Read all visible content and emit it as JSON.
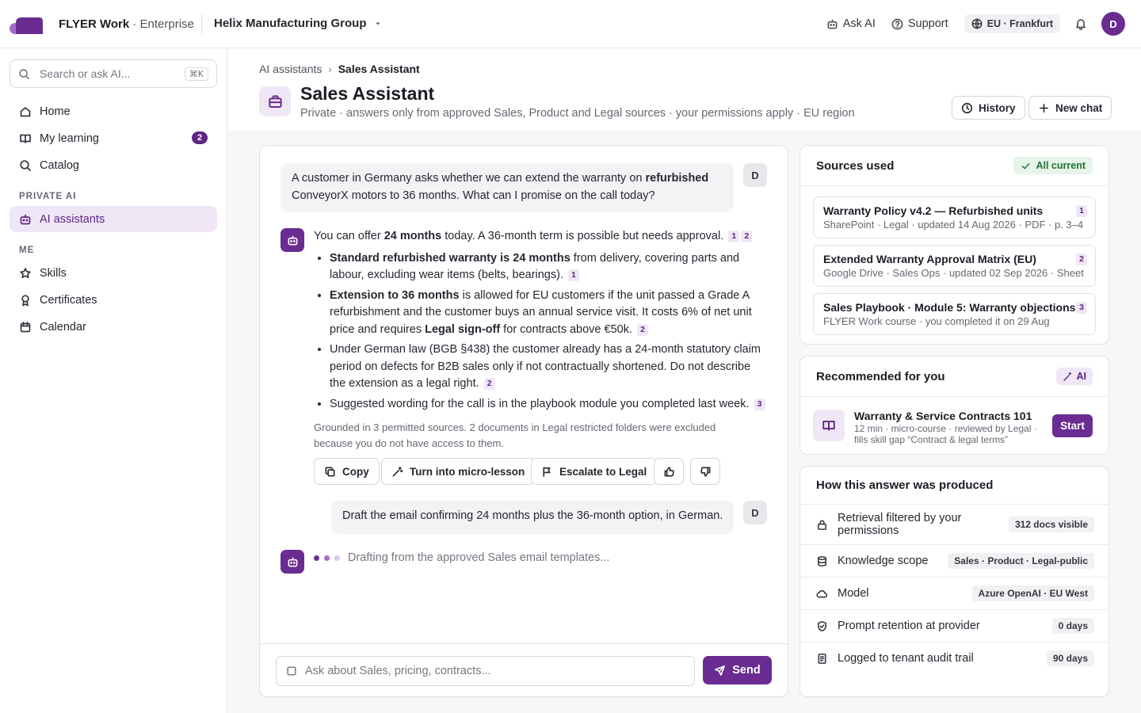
{
  "app": {
    "brand": "FLYER Work",
    "edition": "Enterprise",
    "org": "Helix Manufacturing Group"
  },
  "topbar": {
    "ask_ai": "Ask AI",
    "support": "Support",
    "region": "EU · Frankfurt",
    "avatar": "D"
  },
  "sidebar": {
    "search_placeholder": "Search or ask AI...",
    "search_shortcut": "⌘K",
    "items": [
      {
        "label": "Home",
        "icon": "home-icon"
      },
      {
        "label": "My learning",
        "icon": "book-icon",
        "badge": "2"
      },
      {
        "label": "Catalog",
        "icon": "search-icon"
      }
    ],
    "section_private": "PRIVATE AI",
    "ai_assistants": "AI assistants",
    "section_me": "ME",
    "me_items": [
      {
        "label": "Skills",
        "icon": "star-icon"
      },
      {
        "label": "Certificates",
        "icon": "ribbon-icon"
      },
      {
        "label": "Calendar",
        "icon": "calendar-icon"
      }
    ]
  },
  "header": {
    "crumb_parent": "AI assistants",
    "crumb_current": "Sales Assistant",
    "title": "Sales Assistant",
    "subtitle": "Private · answers only from approved Sales, Product and Legal sources · your permissions apply · EU region",
    "history": "History",
    "new_chat": "New chat"
  },
  "chat": {
    "user_avatar": "D",
    "q1_a": "A customer in Germany asks whether we can extend the warranty on ",
    "q1_b": "refurbished",
    "q1_c": " ConveyorX motors to 36 months. What can I promise on the call today?",
    "a_intro_a": "You can offer ",
    "a_intro_b": "24 months",
    "a_intro_c": " today. A 36-month term is possible but needs approval.",
    "b1_bold": "Standard refurbished warranty is 24 months",
    "b1_text": " from delivery, covering parts and labour, excluding wear items (belts, bearings).",
    "b2_bold": "Extension to 36 months",
    "b2_text": " is allowed for EU customers if the unit passed a Grade A refurbishment and the customer buys an annual service visit. It costs 6% of net unit price and requires ",
    "b2_bold2": "Legal sign-off",
    "b2_text2": " for contracts above €50k.",
    "b3_text": "Under German law (BGB §438) the customer already has a 24-month statutory claim period on defects for B2B sales only if not contractually shortened. Do not describe the extension as a legal right.",
    "b4_text": "Suggested wording for the call is in the playbook module you completed last week.",
    "c1": "1",
    "c2": "2",
    "c3": "3",
    "grounded": "Grounded in 3 permitted sources. 2 documents in Legal restricted folders were excluded because you do not have access to them.",
    "copy": "Copy",
    "micro": "Turn into micro-lesson",
    "escalate": "Escalate to Legal",
    "q2": "Draft the email confirming 24 months plus the 36-month option, in German.",
    "typing": "Drafting from the approved Sales email templates...",
    "placeholder": "Ask about Sales, pricing, contracts...",
    "send": "Send"
  },
  "sources": {
    "title": "Sources used",
    "status": "All current",
    "items": [
      {
        "title": "Warranty Policy v4.2 — Refurbished units",
        "meta": "SharePoint · Legal · updated 14 Aug 2026 · PDF · p. 3–4",
        "n": "1"
      },
      {
        "title": "Extended Warranty Approval Matrix (EU)",
        "meta": "Google Drive · Sales Ops · updated 02 Sep 2026 · Sheet",
        "n": "2"
      },
      {
        "title": "Sales Playbook · Module 5: Warranty objections",
        "meta": "FLYER Work course · you completed it on 29 Aug",
        "n": "3"
      }
    ]
  },
  "recommended": {
    "title": "Recommended for you",
    "badge": "AI",
    "course": "Warranty & Service Contracts 101",
    "meta": "12 min · micro-course · reviewed by Legal · fills skill gap “Contract & legal terms”",
    "start": "Start"
  },
  "produced": {
    "title": "How this answer was produced",
    "rows": [
      {
        "label": "Retrieval filtered by your permissions",
        "value": "312 docs visible",
        "icon": "lock-icon"
      },
      {
        "label": "Knowledge scope",
        "value": "Sales · Product · Legal-public",
        "icon": "database-icon"
      },
      {
        "label": "Model",
        "value": "Azure OpenAI · EU West",
        "icon": "cloud-icon"
      },
      {
        "label": "Prompt retention at provider",
        "value": "0 days",
        "icon": "shield-icon"
      },
      {
        "label": "Logged to tenant audit trail",
        "value": "90 days",
        "icon": "document-icon"
      }
    ]
  },
  "colors": {
    "accent": "#6b2c91",
    "accent_soft": "#f0e7f6",
    "success": "#1f6f35"
  }
}
